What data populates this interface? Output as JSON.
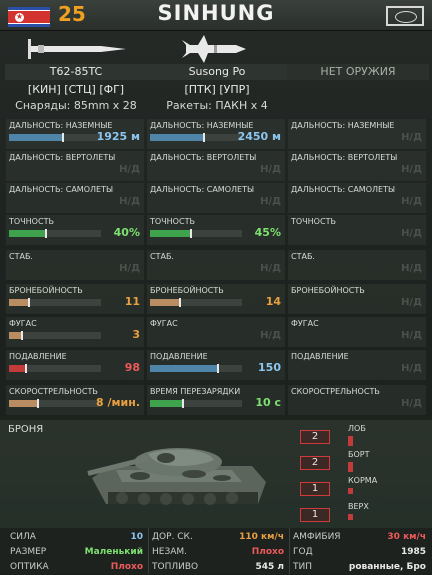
{
  "header": {
    "cost": "25",
    "title": "SINHUNG",
    "colors": {
      "cost": "#f0a020",
      "flag_red": "#d2332e",
      "flag_blue": "#2b4fa6"
    }
  },
  "weapons": [
    {
      "name": "T62-85TC",
      "tags": "[КИН] [СТЦ] [ФГ]",
      "ammo": "Снаряды: 85mm x 28",
      "stats": [
        {
          "label": "Дальность: наземные",
          "value": "1925 м",
          "bar": 0.59,
          "color": "blue"
        },
        {
          "label": "Дальность: вертолеты",
          "value": "Н/Д"
        },
        {
          "label": "Дальность: самолеты",
          "value": "Н/Д"
        },
        {
          "label": "Точность",
          "value": "40%",
          "bar": 0.4,
          "color": "green"
        },
        {
          "label": "Стаб.",
          "value": "Н/Д"
        },
        {
          "label": "Бронебойность",
          "value": "11",
          "bar": 0.22,
          "color": "tan"
        },
        {
          "label": "Фугас",
          "value": "3",
          "bar": 0.14,
          "color": "tan"
        },
        {
          "label": "Подавление",
          "value": "98",
          "bar": 0.19,
          "color": "red"
        },
        {
          "label": "Скорострельность",
          "value": "8 /мин.",
          "bar": 0.31,
          "color": "tan"
        }
      ]
    },
    {
      "name": "Susong Po",
      "tags": "[ПТК] [УПР]",
      "ammo": "Ракеты: ПАКН x 4",
      "stats": [
        {
          "label": "Дальность: наземные",
          "value": "2450 м",
          "bar": 0.59,
          "color": "blue"
        },
        {
          "label": "Дальность: вертолеты",
          "value": "Н/Д"
        },
        {
          "label": "Дальность: самолеты",
          "value": "Н/Д"
        },
        {
          "label": "Точность",
          "value": "45%",
          "bar": 0.45,
          "color": "green"
        },
        {
          "label": "Стаб.",
          "value": "Н/Д"
        },
        {
          "label": "Бронебойность",
          "value": "14",
          "bar": 0.33,
          "color": "tan"
        },
        {
          "label": "Фугас",
          "value": "Н/Д"
        },
        {
          "label": "Подавление",
          "value": "150",
          "bar": 0.74,
          "color": "blue"
        },
        {
          "label": "Время перезарядки",
          "value": "10 с",
          "bar": 0.36,
          "color": "green"
        }
      ]
    },
    {
      "name": "НЕТ ОРУЖИЯ",
      "tags": "",
      "ammo": "",
      "stats": [
        {
          "label": "Дальность: наземные",
          "value": "Н/Д"
        },
        {
          "label": "Дальность: вертолеты",
          "value": "Н/Д"
        },
        {
          "label": "Дальность: самолеты",
          "value": "Н/Д"
        },
        {
          "label": "Точность",
          "value": "Н/Д"
        },
        {
          "label": "Стаб.",
          "value": "Н/Д"
        },
        {
          "label": "Бронебойность",
          "value": "Н/Д"
        },
        {
          "label": "Фугас",
          "value": "Н/Д"
        },
        {
          "label": "Подавление",
          "value": "Н/Д"
        },
        {
          "label": "Скорострельность",
          "value": "Н/Д"
        }
      ]
    }
  ],
  "armor": {
    "label": "БРОНЯ",
    "rows": [
      {
        "label": "ЛОБ",
        "value": "2"
      },
      {
        "label": "БОРТ",
        "value": "2"
      },
      {
        "label": "КОРМА",
        "value": "1"
      },
      {
        "label": "ВЕРХ",
        "value": "1"
      }
    ]
  },
  "specs": [
    [
      {
        "k": "Сила",
        "v": "10",
        "c": "vblue"
      },
      {
        "k": "Дор. ск.",
        "v": "110 км/ч",
        "c": "vorange"
      },
      {
        "k": "Амфибия",
        "v": "30 км/ч",
        "c": "vred"
      }
    ],
    [
      {
        "k": "Размер",
        "v": "Маленький",
        "c": "vgreen"
      },
      {
        "k": "Незам.",
        "v": "Плохо",
        "c": "vred"
      },
      {
        "k": "Год",
        "v": "1985",
        "c": "vwhite"
      }
    ],
    [
      {
        "k": "Оптика",
        "v": "Плохо",
        "c": "vred"
      },
      {
        "k": "Топливо",
        "v": "545 л",
        "c": "vwhite"
      },
      {
        "k": "Тип",
        "v": "рованные, Бро",
        "c": "vwhite"
      }
    ]
  ]
}
